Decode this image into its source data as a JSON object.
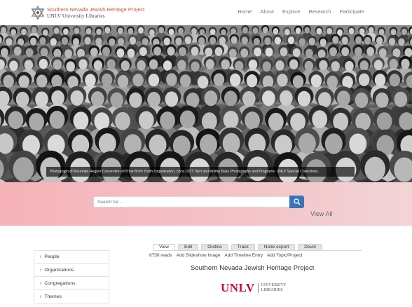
{
  "header": {
    "logo_line1": "Southern Nevada Jewish Heritage Project",
    "logo_line2": "UNLV University Libraries",
    "logo_icon": "star-of-david-icon"
  },
  "nav": {
    "items": [
      {
        "label": "Home"
      },
      {
        "label": "About"
      },
      {
        "label": "Explore"
      },
      {
        "label": "Research"
      },
      {
        "label": "Participate"
      }
    ]
  },
  "hero": {
    "caption": "Photograph of Mountain Region Convention of B'nai B'rith Youth Organization, circa 1977. Bert and Wilma Bass Photographs and Programs. UNLV Special Collections."
  },
  "search": {
    "placeholder": "Search for...",
    "button_icon": "search-icon",
    "view_all": "View All"
  },
  "sidebar": {
    "items": [
      {
        "label": "People"
      },
      {
        "label": "Organizations"
      },
      {
        "label": "Congregations"
      },
      {
        "label": "Themes"
      }
    ]
  },
  "tabs": {
    "items": [
      {
        "label": "View",
        "active": true
      },
      {
        "label": "Edit"
      },
      {
        "label": "Outline"
      },
      {
        "label": "Track"
      },
      {
        "label": "Node export"
      },
      {
        "label": "Devel"
      }
    ]
  },
  "actions": {
    "reads": "8758 reads",
    "items": [
      {
        "label": "Add Slideshow Image"
      },
      {
        "label": "Add Timeline Entry"
      },
      {
        "label": "Add Topic/Project"
      }
    ]
  },
  "content": {
    "title": "Southern Nevada Jewish Heritage Project"
  },
  "unlv_logo": {
    "word": "UNLV",
    "sub1": "UNIVERSITY",
    "sub2": "LIBRARIES"
  },
  "colors": {
    "accent": "#3b73b9",
    "band": "#f6b3b9",
    "unlv_red": "#c8102e"
  }
}
